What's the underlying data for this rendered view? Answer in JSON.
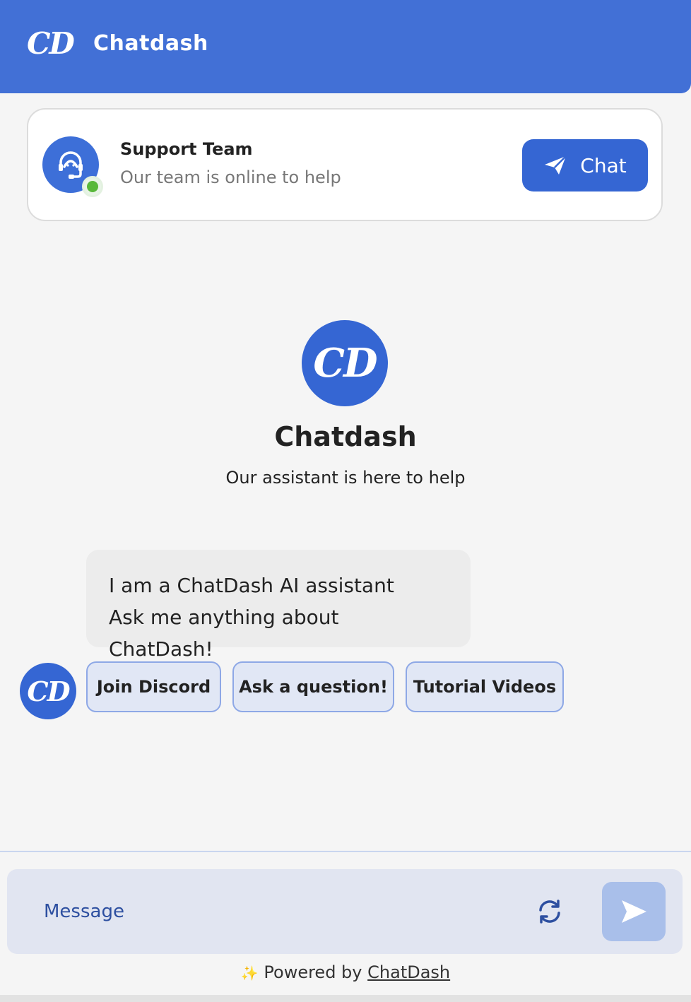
{
  "header": {
    "logo_text": "CD",
    "title": "Chatdash"
  },
  "support": {
    "name": "Support Team",
    "status": "Our team is online to help",
    "chat_button": "Chat"
  },
  "hero": {
    "logo_text": "CD",
    "title": "Chatdash",
    "subtitle": "Our assistant is here to help"
  },
  "message": {
    "lines": [
      "I am a ChatDash AI assistant",
      "Ask me anything about ChatDash!"
    ],
    "avatar_text": "CD"
  },
  "quick_replies": [
    "Join Discord",
    "Ask a question!",
    "Tutorial Videos"
  ],
  "composer": {
    "placeholder": "Message"
  },
  "footer": {
    "prefix": "Powered by",
    "brand": "ChatDash",
    "sparkle": "✨"
  },
  "colors": {
    "primary": "#4270d6",
    "button": "#3566d3",
    "online": "#58b83a"
  },
  "icons": [
    "support-agent-icon",
    "paper-plane-icon",
    "refresh-icon",
    "send-icon",
    "sparkle-icon"
  ]
}
